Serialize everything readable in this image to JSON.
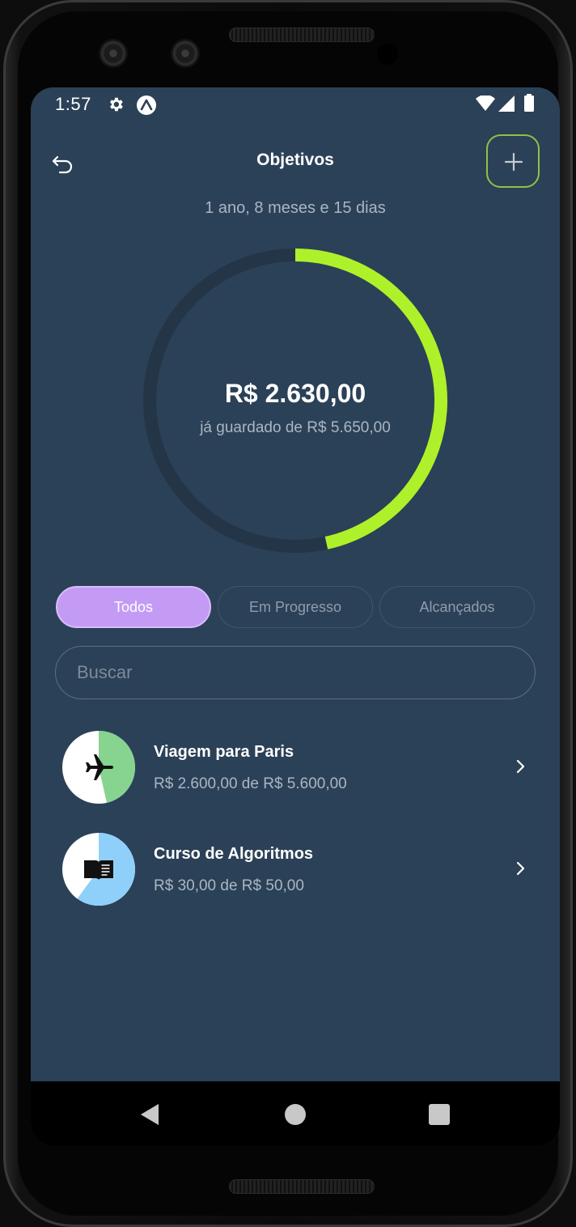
{
  "status_bar": {
    "time": "1:57"
  },
  "header": {
    "title": "Objetivos",
    "back_icon": "undo-arrow-icon",
    "add_icon": "plus-icon"
  },
  "summary": {
    "duration": "1 ano, 8 meses e 15 dias",
    "saved_amount": "R$ 2.630,00",
    "caption": "já guardado de R$ 5.650,00",
    "progress_fraction": 0.4655
  },
  "filters": {
    "tabs": [
      {
        "label": "Todos",
        "active": true
      },
      {
        "label": "Em Progresso",
        "active": false
      },
      {
        "label": "Alcançados",
        "active": false
      }
    ]
  },
  "search": {
    "placeholder": "Buscar",
    "value": ""
  },
  "goals": [
    {
      "title": "Viagem para Paris",
      "amount": "R$ 2.600,00 de R$ 5.600,00",
      "icon": "airplane-icon",
      "progress_fraction": 0.4643,
      "color": "#86d48f"
    },
    {
      "title": "Curso de Algoritmos",
      "amount": "R$ 30,00 de R$ 50,00",
      "icon": "book-icon",
      "progress_fraction": 0.6,
      "color": "#8fd0fb"
    }
  ],
  "colors": {
    "background": "#2b4157",
    "accent_green": "#aef12a",
    "active_tab": "#c39bf5",
    "ring_track": "#233547"
  }
}
